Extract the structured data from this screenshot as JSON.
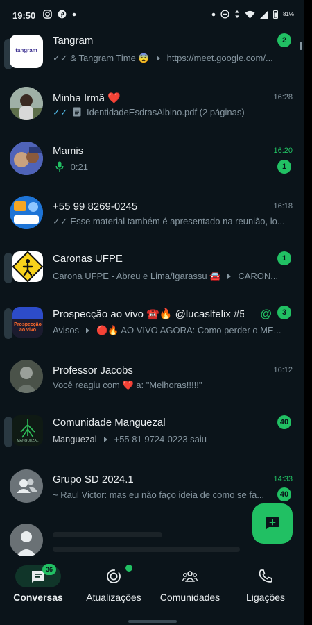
{
  "status_bar": {
    "time": "19:50",
    "battery": "81%"
  },
  "chats": [
    {
      "name": "Tangram",
      "avatar_text": "tangram",
      "subgroup": "✓✓ & Tangram Time 😨",
      "preview": "https://meet.google.com/...",
      "time": "",
      "unread": "2",
      "type": "community"
    },
    {
      "name": "Minha Irmã ❤️",
      "ticks": "✓✓",
      "preview": "IdentidadeEsdrasAlbino.pdf (2 páginas)",
      "time": "16:28",
      "type": "chat"
    },
    {
      "name": "Mamis",
      "preview": "0:21",
      "time": "16:20",
      "unread": "1",
      "type": "chat"
    },
    {
      "name": "+55 99 8269-0245",
      "ticks": "✓✓",
      "preview": "Esse material também é apresentado na reunião, lo...",
      "time": "16:18",
      "type": "chat"
    },
    {
      "name": "Caronas UFPE",
      "subgroup": "Carona UFPE - Abreu e Lima/Igarassu 🚘",
      "preview": "CARON...",
      "unread": "1",
      "type": "community"
    },
    {
      "name": "Prospecção ao vivo ☎️🔥 @lucaslfelix #5",
      "avatar_text": "Prospecção ao vivo",
      "subgroup": "Avisos",
      "preview": "🔴🔥 AO VIVO AGORA: Como perder o ME...",
      "mention": "@",
      "unread": "3",
      "type": "community"
    },
    {
      "name": "Professor Jacobs",
      "preview": "Você reagiu com ❤️ a: \"Melhoras!!!!!\"",
      "time": "16:12",
      "type": "chat"
    },
    {
      "name": "Comunidade Manguezal",
      "avatar_text": "MANGUEZAL",
      "subgroup": "Manguezal",
      "preview": "+55 81 9724-0223 saiu",
      "unread": "40",
      "type": "community"
    },
    {
      "name": "Grupo SD 2024.1",
      "preview": "~ Raul Victor: mas eu não faço ideia de como se fa...",
      "time": "14:33",
      "unread": "40",
      "type": "group"
    }
  ],
  "nav": {
    "chats_label": "Conversas",
    "chats_badge": "36",
    "updates_label": "Atualizações",
    "communities_label": "Comunidades",
    "calls_label": "Ligações"
  },
  "colors": {
    "background": "#0b141a",
    "accent": "#21c063",
    "text_primary": "#e9edef",
    "text_secondary": "#8696a0",
    "read_ticks": "#53bdeb"
  },
  "icons": {
    "fab": "new-chat-icon",
    "nav": [
      "chats-icon",
      "updates-icon",
      "communities-icon",
      "calls-icon"
    ]
  }
}
